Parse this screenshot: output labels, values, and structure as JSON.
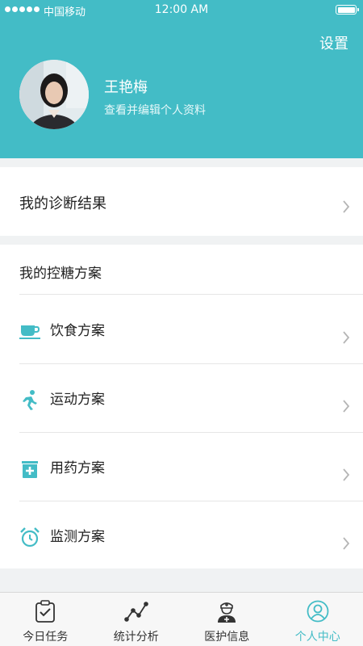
{
  "status_bar": {
    "carrier": "中国移动",
    "time": "12:00 AM"
  },
  "header": {
    "settings_label": "设置"
  },
  "profile": {
    "name": "王艳梅",
    "subtitle": "查看并编辑个人资料"
  },
  "diagnosis": {
    "label": "我的诊断结果"
  },
  "plan_section": {
    "title": "我的控糖方案",
    "items": [
      {
        "label": "饮食方案",
        "icon": "coffee-cup-icon"
      },
      {
        "label": "运动方案",
        "icon": "running-icon"
      },
      {
        "label": "用药方案",
        "icon": "medicine-icon"
      },
      {
        "label": "监测方案",
        "icon": "alarm-clock-icon"
      }
    ]
  },
  "tabbar": {
    "active": "个人中心",
    "tabs": [
      {
        "label": "今日任务",
        "icon": "clipboard-check-icon"
      },
      {
        "label": "统计分析",
        "icon": "line-chart-icon"
      },
      {
        "label": "医护信息",
        "icon": "nurse-icon"
      },
      {
        "label": "个人中心",
        "icon": "user-circle-icon"
      }
    ]
  },
  "colors": {
    "accent": "#43bcc6",
    "background": "#f0f2f3",
    "text": "#222222",
    "chevron": "#b5b5b5"
  }
}
